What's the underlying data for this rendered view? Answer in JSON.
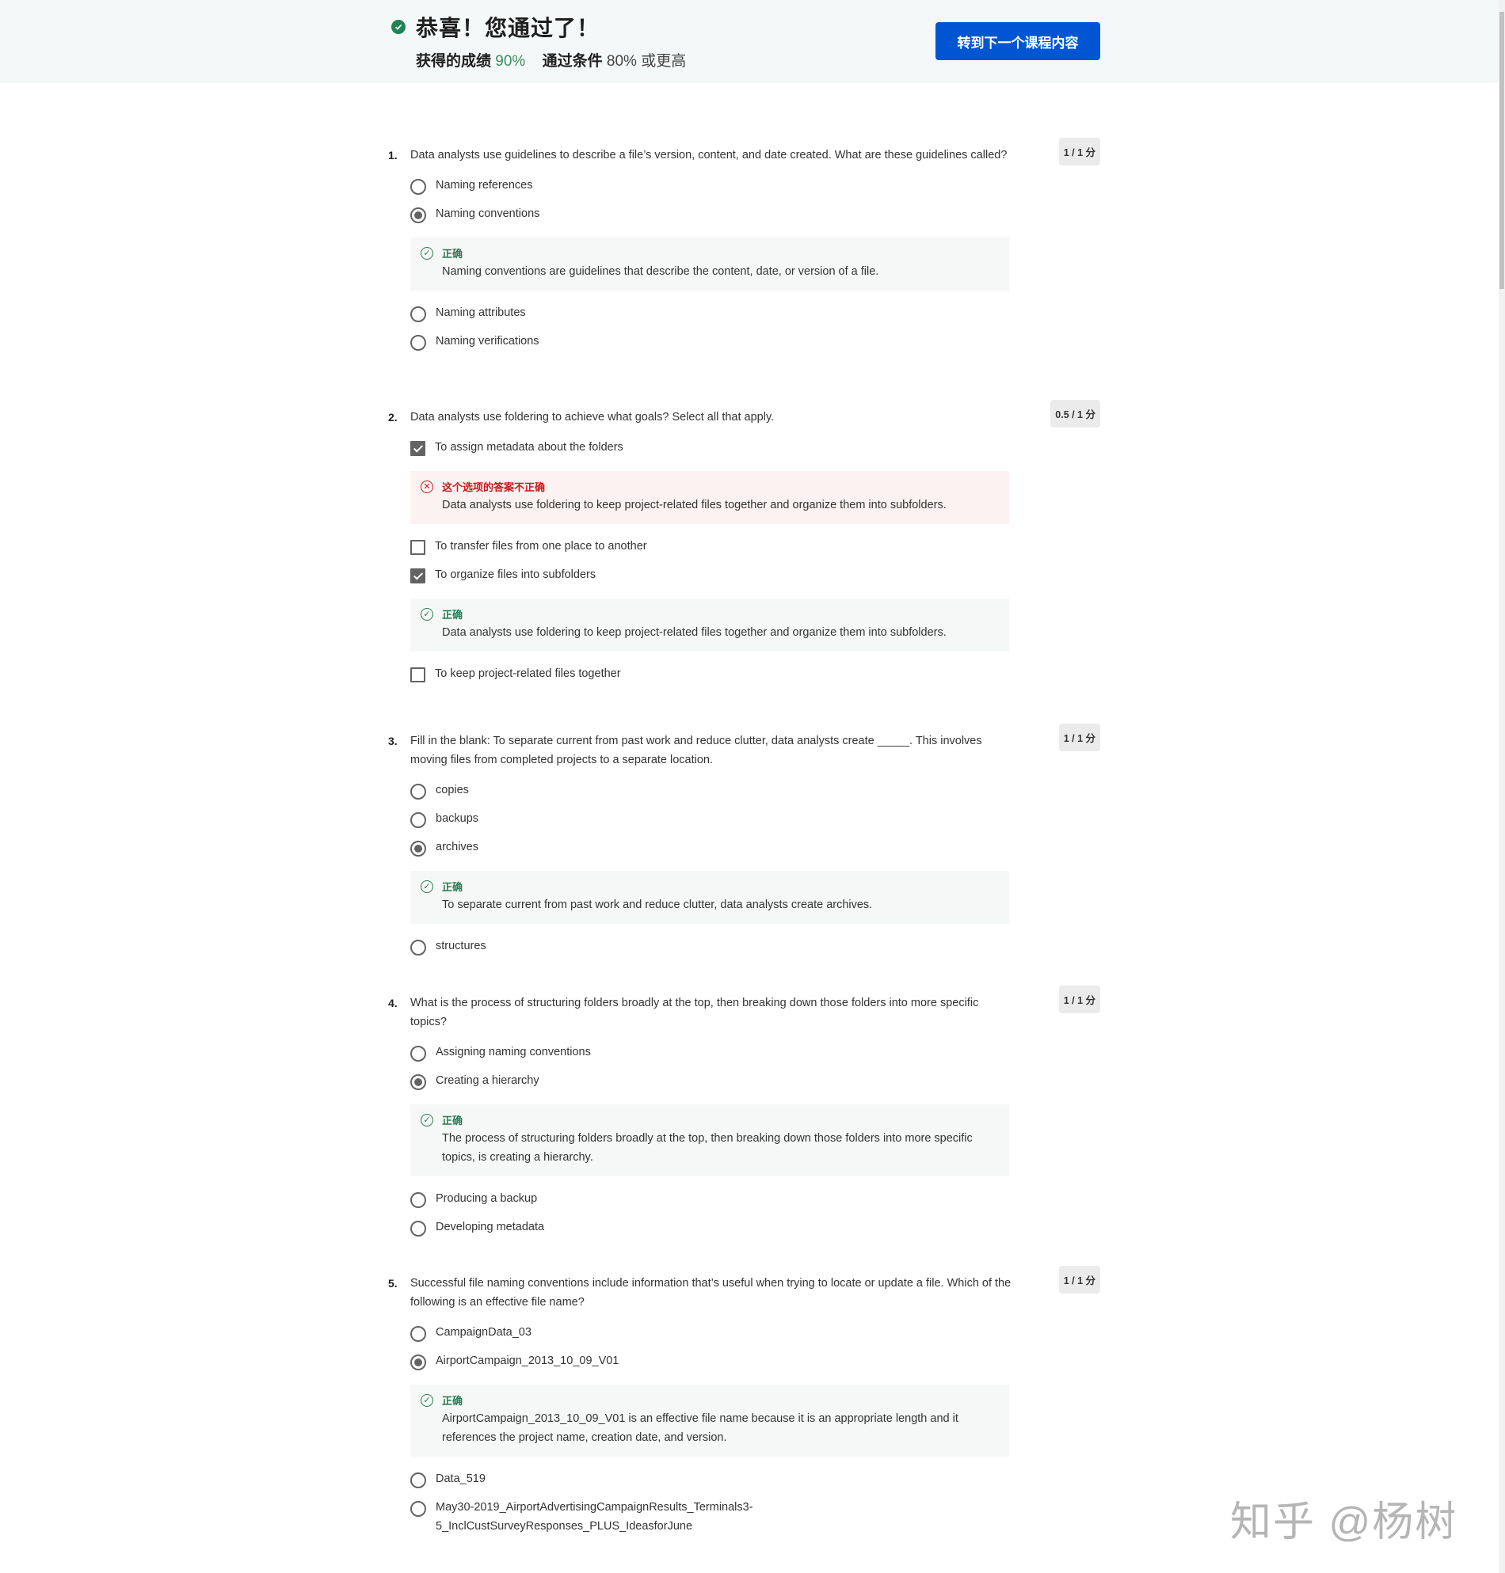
{
  "header": {
    "title": "恭喜！您通过了！",
    "score_label": "获得的成绩",
    "score_value": "90%",
    "pass_label": "通过条件",
    "pass_value": "80% 或更高",
    "next_button": "转到下一个课程内容",
    "colors": {
      "accent": "#0056d2",
      "success": "#1f8354",
      "error": "#c11b1b"
    }
  },
  "feedback_labels": {
    "correct": "正确",
    "incorrect": "这个选项的答案不正确"
  },
  "questions": [
    {
      "number": "1.",
      "text": "Data analysts use guidelines to describe a file’s version, content, and date created. What are these guidelines called?",
      "score": "1 / 1 分",
      "type": "radio",
      "options": [
        {
          "label": "Naming references",
          "selected": false
        },
        {
          "label": "Naming conventions",
          "selected": true,
          "feedback": {
            "status": "correct",
            "text": "Naming conventions are guidelines that describe the content, date, or version of a file."
          }
        },
        {
          "label": "Naming attributes",
          "selected": false
        },
        {
          "label": "Naming verifications",
          "selected": false
        }
      ]
    },
    {
      "number": "2.",
      "text": "Data analysts use foldering to achieve what goals? Select all that apply.",
      "score": "0.5 / 1 分",
      "type": "checkbox",
      "options": [
        {
          "label": "To assign metadata about the folders",
          "selected": true,
          "feedback": {
            "status": "incorrect",
            "text": "Data analysts use foldering to keep project-related files together and organize them into subfolders."
          }
        },
        {
          "label": "To transfer files from one place to another",
          "selected": false
        },
        {
          "label": "To organize files into subfolders",
          "selected": true,
          "feedback": {
            "status": "correct",
            "text": "Data analysts use foldering to keep project-related files together and organize them into subfolders."
          }
        },
        {
          "label": "To keep project-related files together",
          "selected": false
        }
      ]
    },
    {
      "number": "3.",
      "text": "Fill in the blank: To separate current from past work and reduce clutter, data analysts create _____. This involves moving files from completed projects to a separate location.",
      "score": "1 / 1 分",
      "type": "radio",
      "options": [
        {
          "label": "copies",
          "selected": false
        },
        {
          "label": "backups",
          "selected": false
        },
        {
          "label": "archives",
          "selected": true,
          "feedback": {
            "status": "correct",
            "text": "To separate current from past work and reduce clutter, data analysts create archives."
          }
        },
        {
          "label": "structures",
          "selected": false
        }
      ]
    },
    {
      "number": "4.",
      "text": "What is the process of structuring folders broadly at the top, then breaking down those folders into more specific topics?",
      "score": "1 / 1 分",
      "type": "radio",
      "options": [
        {
          "label": "Assigning naming conventions",
          "selected": false
        },
        {
          "label": "Creating a hierarchy",
          "selected": true,
          "feedback": {
            "status": "correct",
            "text": "The process of structuring folders broadly at the top, then breaking down those folders into more specific topics, is creating a hierarchy."
          }
        },
        {
          "label": "Producing a backup",
          "selected": false
        },
        {
          "label": "Developing metadata",
          "selected": false
        }
      ]
    },
    {
      "number": "5.",
      "text": "Successful file naming conventions include information that’s useful when trying to locate or update a file. Which of the following is an effective file name?",
      "score": "1 / 1 分",
      "type": "radio",
      "options": [
        {
          "label": "CampaignData_03",
          "selected": false
        },
        {
          "label": "AirportCampaign_2013_10_09_V01",
          "selected": true,
          "feedback": {
            "status": "correct",
            "text": "AirportCampaign_2013_10_09_V01 is an effective file name because it is an appropriate length and it references the project name, creation date, and version."
          }
        },
        {
          "label": "Data_519",
          "selected": false
        },
        {
          "label": "May30-2019_AirportAdvertisingCampaignResults_Terminals3-5_InclCustSurveyResponses_PLUS_IdeasforJune",
          "selected": false
        }
      ]
    }
  ],
  "watermark": "知乎 @杨树"
}
